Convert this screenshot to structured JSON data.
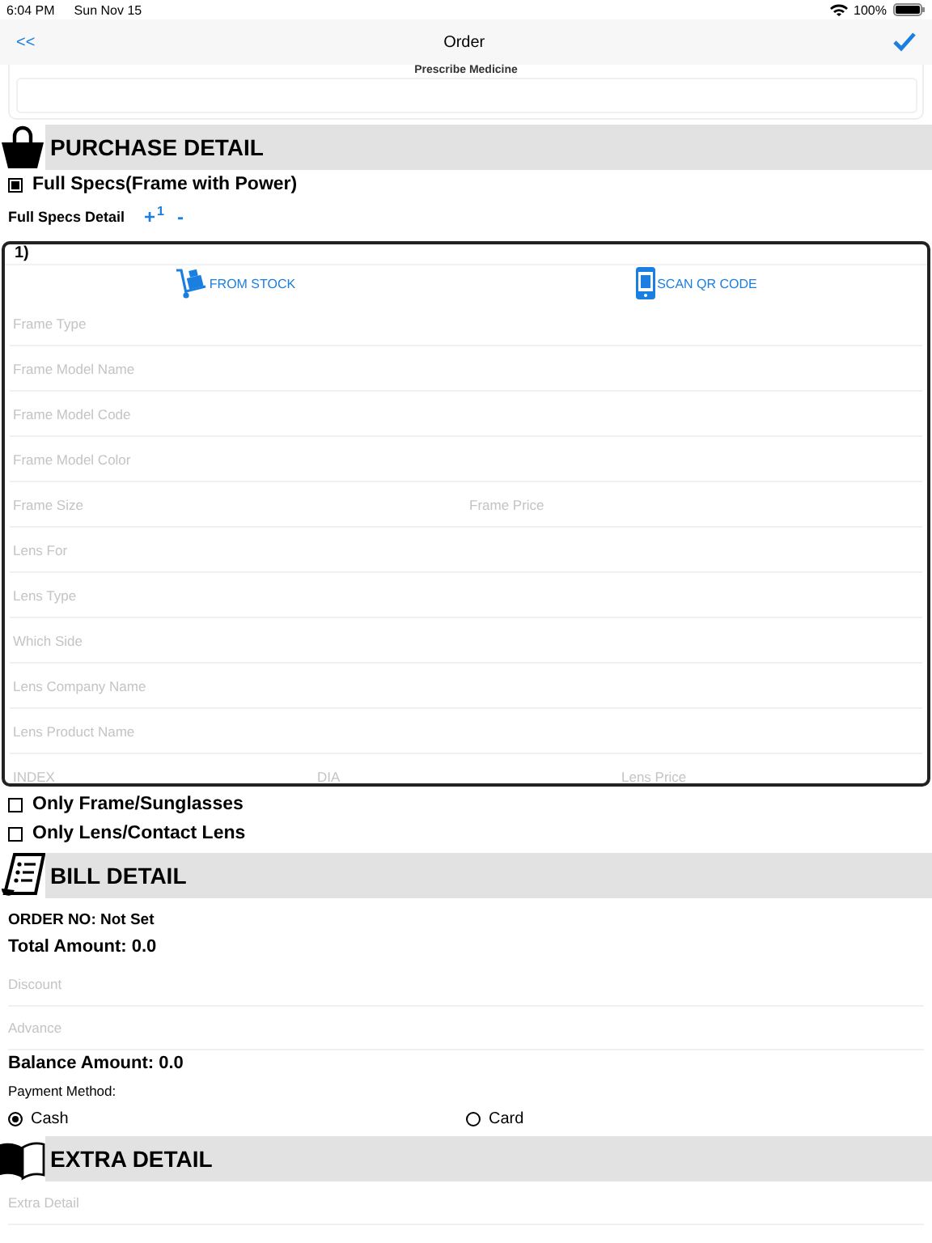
{
  "status_bar": {
    "time": "6:04 PM",
    "date": "Sun Nov 15",
    "battery": "100%"
  },
  "nav": {
    "back": "<<",
    "title": "Order"
  },
  "prescribe": {
    "title": "Prescribe Medicine"
  },
  "purchase": {
    "title": "PURCHASE DETAIL",
    "full_specs": {
      "label": "Full Specs(Frame with Power)",
      "checked": true
    },
    "specs_detail": {
      "label": "Full Specs Detail",
      "plus": "+",
      "count": "1",
      "minus": "-"
    },
    "items": [
      {
        "number": "1)",
        "actions": [
          {
            "kind": "stock",
            "label": "FROM STOCK"
          },
          {
            "kind": "scan",
            "label": "SCAN QR CODE"
          }
        ],
        "rows": [
          [
            {
              "placeholder": "Frame Type"
            }
          ],
          [
            {
              "placeholder": "Frame Model Name"
            }
          ],
          [
            {
              "placeholder": "Frame Model Code"
            }
          ],
          [
            {
              "placeholder": "Frame Model Color"
            }
          ],
          [
            {
              "placeholder": "Frame Size"
            },
            {
              "placeholder": "Frame Price"
            }
          ],
          [
            {
              "placeholder": "Lens For"
            }
          ],
          [
            {
              "placeholder": "Lens Type"
            }
          ],
          [
            {
              "placeholder": "Which Side"
            }
          ],
          [
            {
              "placeholder": "Lens Company Name"
            }
          ],
          [
            {
              "placeholder": "Lens Product Name"
            }
          ],
          [
            {
              "placeholder": "INDEX"
            },
            {
              "placeholder": "DIA"
            },
            {
              "placeholder": "Lens Price"
            }
          ]
        ]
      }
    ],
    "options": [
      {
        "label": "Only Frame/Sunglasses",
        "checked": false
      },
      {
        "label": "Only Lens/Contact Lens",
        "checked": false
      }
    ]
  },
  "bill": {
    "title": "BILL DETAIL",
    "order_no": "ORDER NO: Not Set",
    "total": "Total Amount: 0.0",
    "fields": [
      {
        "placeholder": "Discount"
      },
      {
        "placeholder": "Advance"
      }
    ],
    "balance": "Balance Amount: 0.0",
    "payment_label": "Payment Method:",
    "payment_options": [
      {
        "label": "Cash",
        "selected": true
      },
      {
        "label": "Card",
        "selected": false
      }
    ]
  },
  "extra": {
    "title": "EXTRA DETAIL",
    "field": {
      "placeholder": "Extra Detail"
    }
  }
}
